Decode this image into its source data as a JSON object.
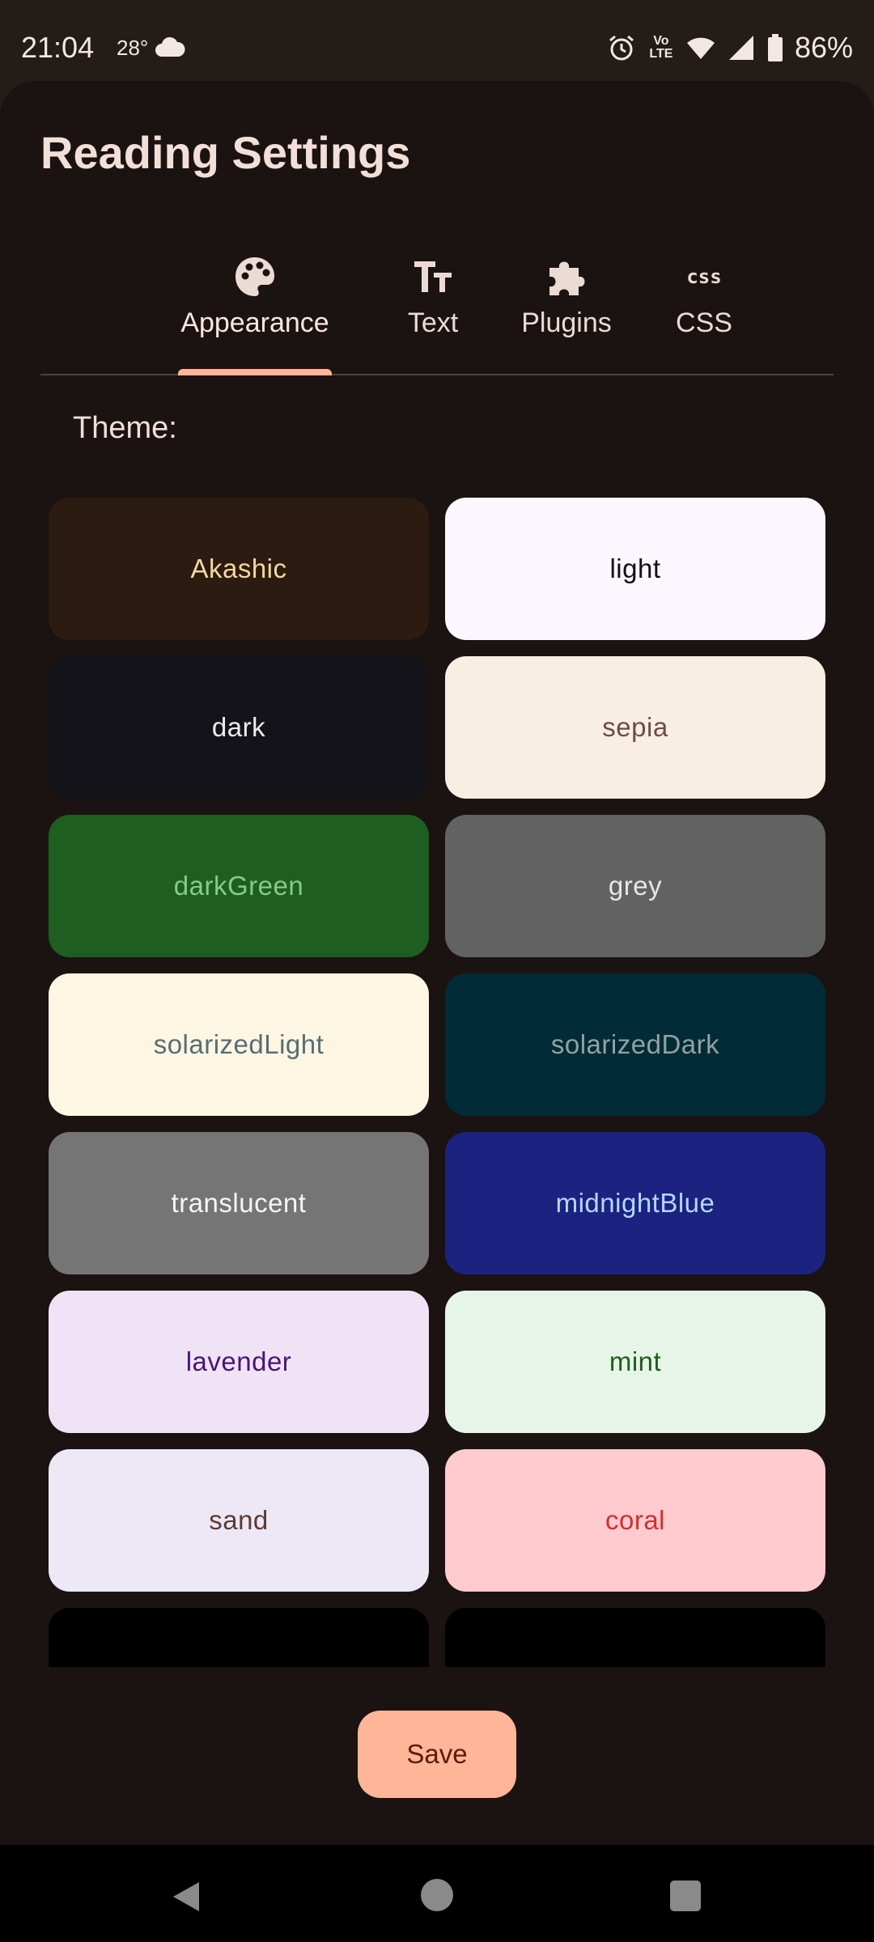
{
  "status_bar": {
    "time": "21:04",
    "temperature": "28°",
    "volte": "Vo LTE",
    "battery": "86%"
  },
  "title": "Reading Settings",
  "tabs": [
    {
      "label": "Appearance",
      "icon": "palette-icon",
      "active": true
    },
    {
      "label": "Text",
      "icon": "text-size-icon",
      "active": false
    },
    {
      "label": "Plugins",
      "icon": "puzzle-icon",
      "active": false
    },
    {
      "label": "CSS",
      "icon": "css-icon",
      "icon_text": "css",
      "active": false
    }
  ],
  "theme_label": "Theme:",
  "themes": [
    {
      "label": "Akashic",
      "bg": "#2b1b11",
      "fg": "#f5d5a2"
    },
    {
      "label": "light",
      "bg": "#fcf6ff",
      "fg": "#111111"
    },
    {
      "label": "dark",
      "bg": "#15131a",
      "fg": "#ececec"
    },
    {
      "label": "sepia",
      "bg": "#f9eee4",
      "fg": "#6d4d40"
    },
    {
      "label": "darkGreen",
      "bg": "#1e5e20",
      "fg": "#86c98a"
    },
    {
      "label": "grey",
      "bg": "#626262",
      "fg": "#e6e6e6"
    },
    {
      "label": "solarizedLight",
      "bg": "#fdf6e3",
      "fg": "#586e75"
    },
    {
      "label": "solarizedDark",
      "bg": "#012b36",
      "fg": "#93a1a1"
    },
    {
      "label": "translucent",
      "bg": "#757575",
      "fg": "#f5f5f5"
    },
    {
      "label": "midnightBlue",
      "bg": "#1b227f",
      "fg": "#b3d7ff"
    },
    {
      "label": "lavender",
      "bg": "#f0e3f5",
      "fg": "#4a1478"
    },
    {
      "label": "mint",
      "bg": "#e6f5e8",
      "fg": "#1e5e20"
    },
    {
      "label": "sand",
      "bg": "#ede8f5",
      "fg": "#5e3a32"
    },
    {
      "label": "coral",
      "bg": "#ffcbce",
      "fg": "#d12f2f"
    },
    {
      "label": "",
      "bg": "#000000",
      "fg": "#ffffff"
    },
    {
      "label": "",
      "bg": "#000000",
      "fg": "#ffffff"
    }
  ],
  "save_label": "Save",
  "colors": {
    "sheet_bg": "#1b1311",
    "accent": "#ffb597",
    "on_accent": "#5c1c06"
  }
}
